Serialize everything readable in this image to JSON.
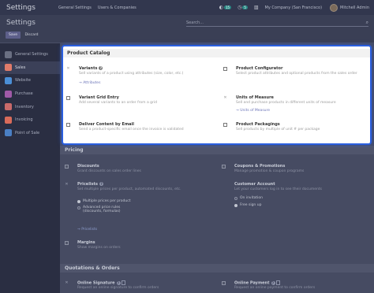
{
  "topbar": {
    "app_title": "Settings",
    "menu": [
      "General Settings",
      "Users & Companies"
    ],
    "chat_count": "15",
    "activity_count": "5",
    "company": "My Company (San Francisco)",
    "user": "Mitchell Admin"
  },
  "control": {
    "title": "Settings",
    "search_placeholder": "Search...",
    "save_label": "Save",
    "discard_label": "Discard"
  },
  "sidebar": {
    "items": [
      {
        "label": "General Settings",
        "color": "#6a6f82"
      },
      {
        "label": "Sales",
        "color": "#e07b6a"
      },
      {
        "label": "Website",
        "color": "#4b8fd6"
      },
      {
        "label": "Purchase",
        "color": "#a05aa8"
      },
      {
        "label": "Inventory",
        "color": "#c96a6a"
      },
      {
        "label": "Invoicing",
        "color": "#d96b5a"
      },
      {
        "label": "Point of Sale",
        "color": "#4a7fc4"
      }
    ]
  },
  "catalog": {
    "header": "Product Catalog",
    "variants": {
      "title": "Variants",
      "desc": "Sell variants of a product using attributes (size, color, etc.)",
      "link": "Attributes"
    },
    "configurator": {
      "title": "Product Configurator",
      "desc": "Select product attributes and optional products from the sales order"
    },
    "variant_grid": {
      "title": "Variant Grid Entry",
      "desc": "Add several variants to an order from a grid"
    },
    "uom": {
      "title": "Units of Measure",
      "desc": "Sell and purchase products in different units of measure",
      "link": "Units of Measure"
    },
    "deliver_email": {
      "title": "Deliver Content by Email",
      "desc": "Send a product-specific email once the invoice is validated"
    },
    "packagings": {
      "title": "Product Packagings",
      "desc": "Sell products by multiple of unit # per package"
    }
  },
  "pricing": {
    "header": "Pricing",
    "discounts": {
      "title": "Discounts",
      "desc": "Grant discounts on sales order lines"
    },
    "coupons": {
      "title": "Coupons & Promotions",
      "desc": "Manage promotion & coupon programs"
    },
    "pricelists": {
      "title": "Pricelists",
      "desc": "Set multiple prices per product, automated discounts, etc.",
      "option1": "Multiple prices per product",
      "option2_line1": "Advanced price rules",
      "option2_line2": "(discounts, formulas)",
      "link": "Pricelists"
    },
    "customer_account": {
      "title": "Customer Account",
      "desc": "Let your customers log in to see their documents",
      "option1": "On invitation",
      "option2": "Free sign up"
    },
    "margins": {
      "title": "Margins",
      "desc": "Show margins on orders"
    }
  },
  "quotations": {
    "header": "Quotations & Orders",
    "online_signature": {
      "title": "Online Signature",
      "desc": "Request an online signature to confirm orders"
    },
    "online_payment": {
      "title": "Online Payment",
      "desc": "Request an online payment to confirm orders"
    }
  }
}
